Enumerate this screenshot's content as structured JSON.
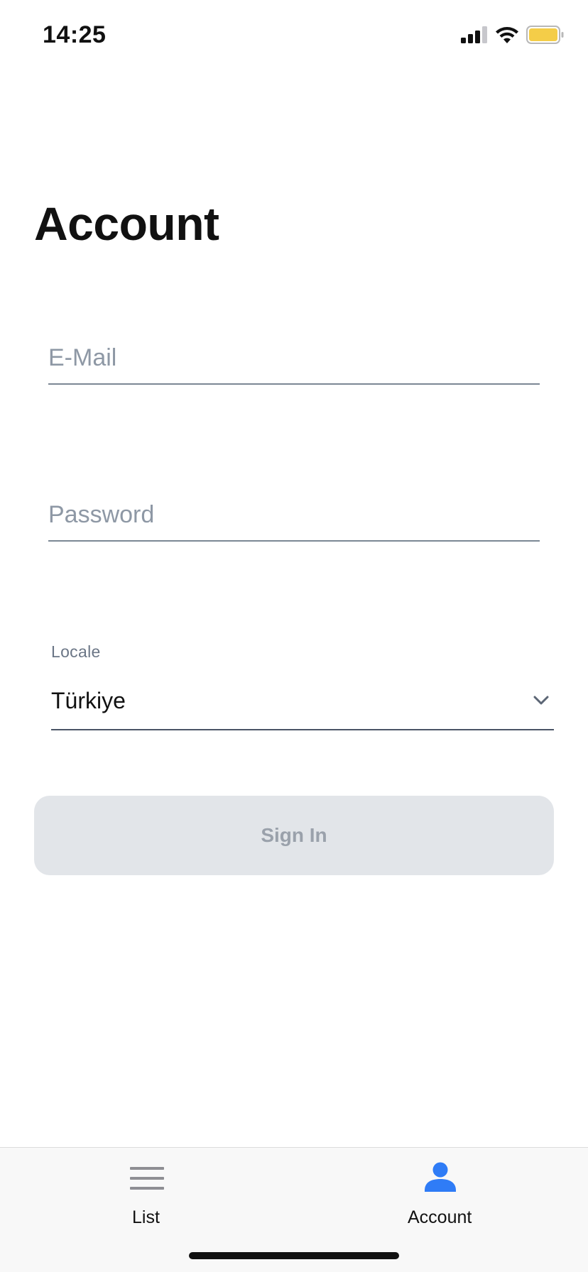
{
  "status_bar": {
    "time": "14:25",
    "icons": [
      "cellular-signal-icon",
      "wifi-icon",
      "battery-icon"
    ],
    "battery_color": "#f4cd48"
  },
  "page": {
    "title": "Account"
  },
  "form": {
    "email": {
      "placeholder": "E-Mail",
      "value": ""
    },
    "password": {
      "placeholder": "Password",
      "value": ""
    },
    "locale": {
      "label": "Locale",
      "selected": "Türkiye",
      "icon": "chevron-down-icon"
    },
    "sign_in_label": "Sign In"
  },
  "tab_bar": {
    "tabs": [
      {
        "label": "List",
        "icon": "list-icon",
        "active": false,
        "color": "#8e8e93"
      },
      {
        "label": "Account",
        "icon": "person-icon",
        "active": true,
        "color": "#2f7cf6"
      }
    ]
  },
  "colors": {
    "accent": "#2f7cf6",
    "button_disabled_bg": "#e2e5e9",
    "button_disabled_text": "#9aa1ab"
  }
}
